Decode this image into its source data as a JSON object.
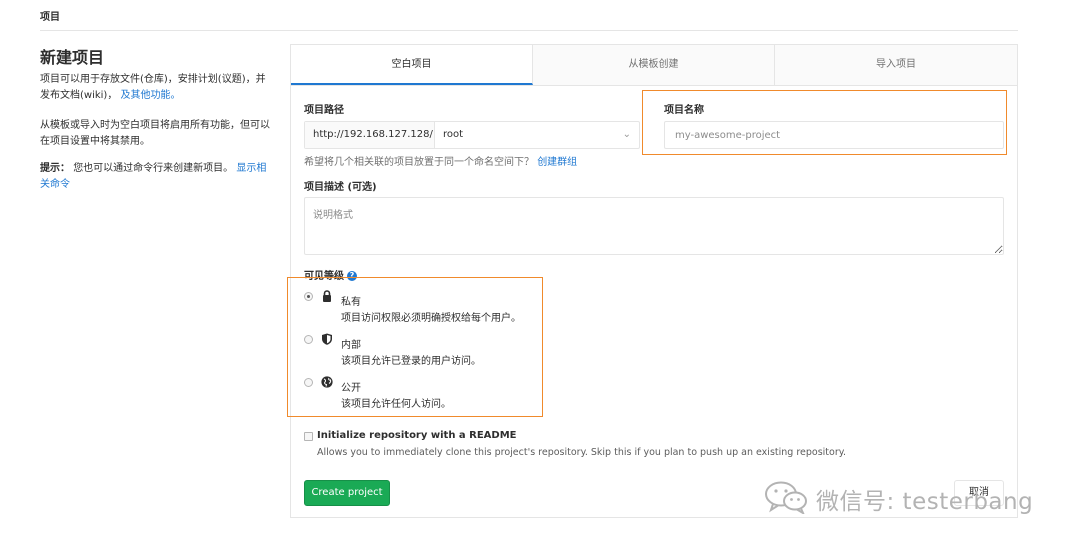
{
  "breadcrumb": "项目",
  "page": {
    "title": "新建项目",
    "info1": "项目可以用于存放文件(仓库)，安排计划(议题)，并发布文档(wiki)，",
    "info1_link": "及其他功能。",
    "info2": "从模板或导入时为空白项目将启用所有功能，但可以在项目设置中将其禁用。",
    "info3_bold": "提示：",
    "info3": "您也可以通过命令行来创建新项目。",
    "info3_link": "显示相关命令"
  },
  "tabs": [
    {
      "label": "空白项目",
      "active": true
    },
    {
      "label": "从模板创建",
      "active": false
    },
    {
      "label": "导入项目",
      "active": false
    }
  ],
  "form": {
    "path_label": "项目路径",
    "path_prefix": "http://192.168.127.128/",
    "namespace": "root",
    "name_label": "项目名称",
    "name_placeholder": "my-awesome-project",
    "group_help": "希望将几个相关联的项目放置于同一个命名空间下？",
    "group_link": "创建群组",
    "desc_label": "项目描述 (可选)",
    "desc_placeholder": "说明格式",
    "visibility_label": "可见等级",
    "visibility": [
      {
        "title": "私有",
        "desc": "项目访问权限必须明确授权给每个用户。",
        "icon": "lock-icon",
        "checked": true
      },
      {
        "title": "内部",
        "desc": "该项目允许已登录的用户访问。",
        "icon": "shield-icon",
        "checked": false
      },
      {
        "title": "公开",
        "desc": "该项目允许任何人访问。",
        "icon": "globe-icon",
        "checked": false
      }
    ],
    "readme_label": "Initialize repository with a README",
    "readme_help": "Allows you to immediately clone this project's repository. Skip this if you plan to push up an existing repository.",
    "create_label": "Create project",
    "cancel_label": "取消"
  },
  "watermark": "微信号: testerbang",
  "colors": {
    "accent": "#1f78d1",
    "create": "#1aaa55",
    "highlight": "#f08a2c"
  }
}
